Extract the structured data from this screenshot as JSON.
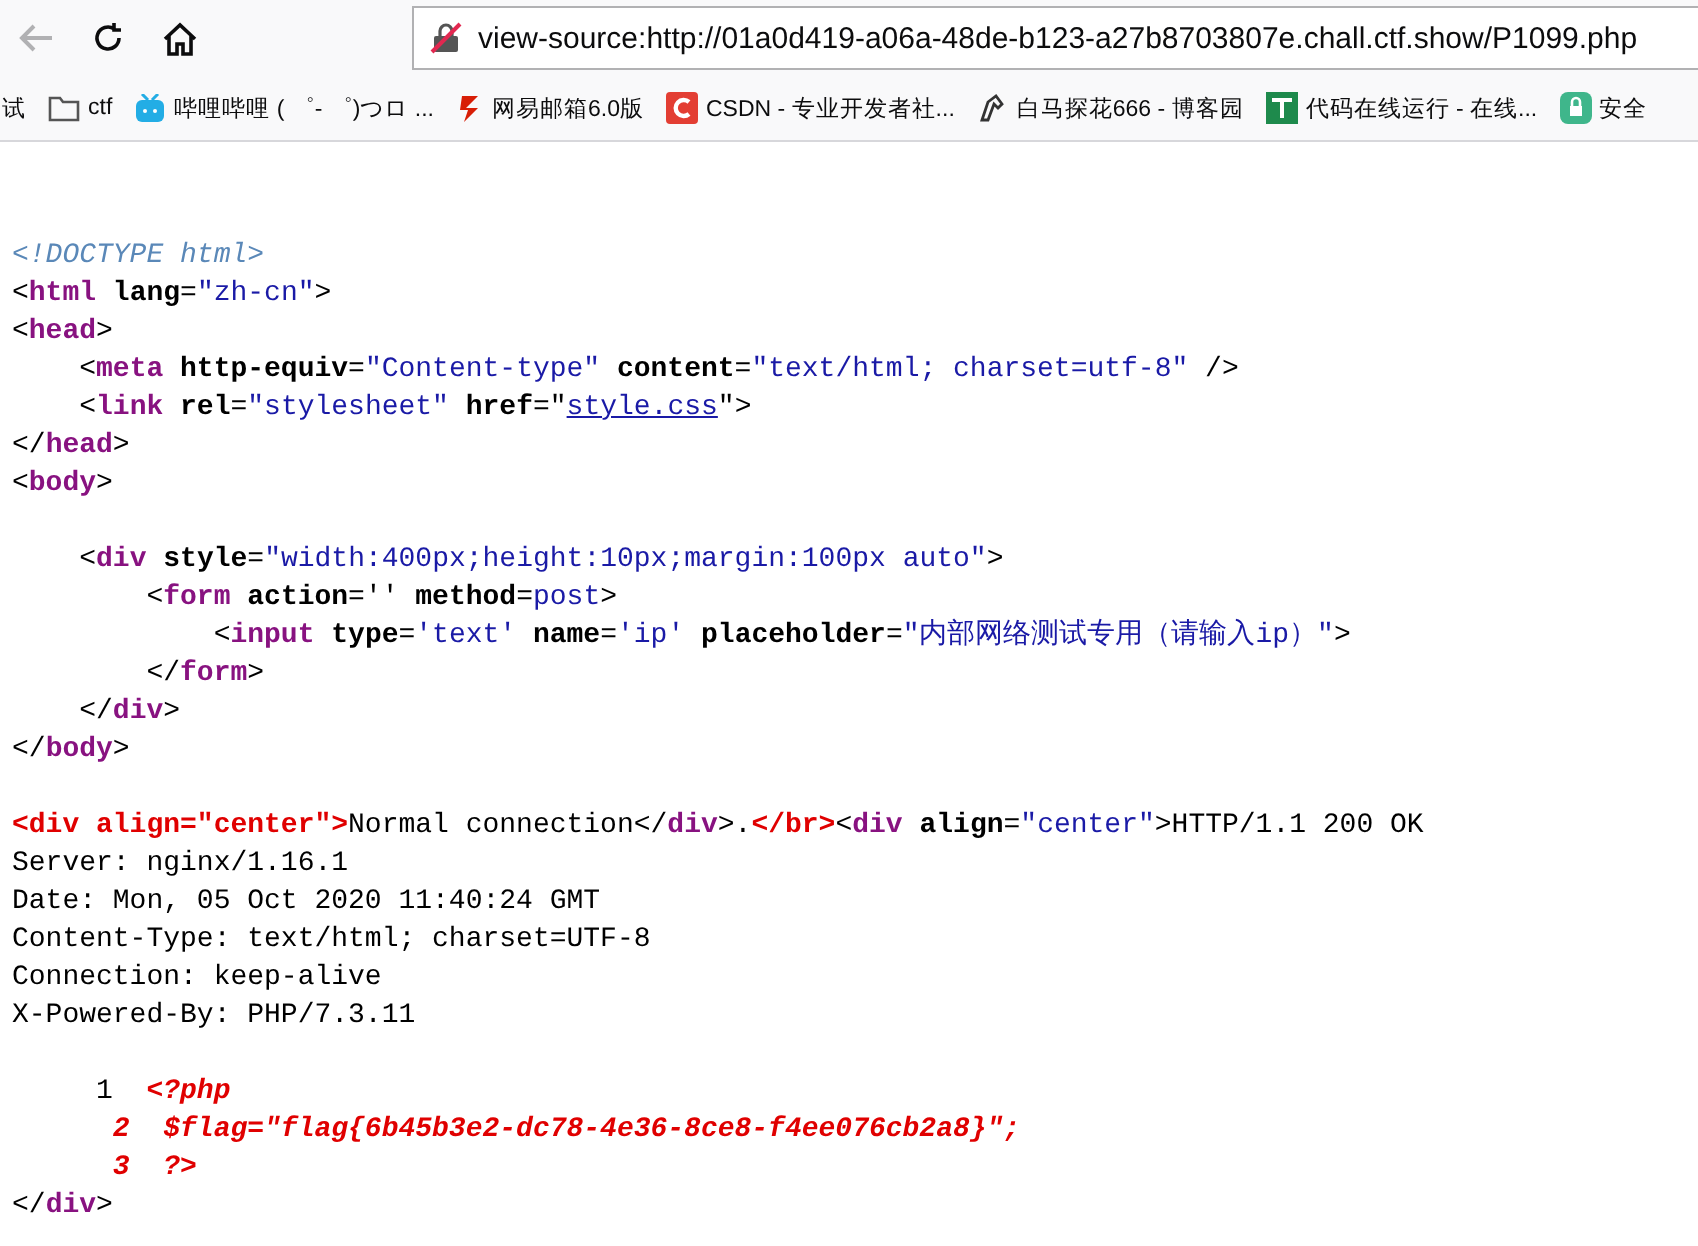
{
  "toolbar": {
    "back_disabled": true,
    "url": "view-source:http://01a0d419-a06a-48de-b123-a27b8703807e.chall.ctf.show/P1099.php"
  },
  "bookmarks": [
    {
      "kind": "plain",
      "label": "试"
    },
    {
      "kind": "folder",
      "label": "ctf"
    },
    {
      "kind": "tv",
      "label": "哔哩哔哩 ( ゜- ゜)つロ ..."
    },
    {
      "kind": "mail",
      "label": "网易邮箱6.0版"
    },
    {
      "kind": "c",
      "label": "CSDN - 专业开发者社..."
    },
    {
      "kind": "horse",
      "label": "白马探花666 - 博客园"
    },
    {
      "kind": "t",
      "label": "代码在线运行 - 在线..."
    },
    {
      "kind": "shield",
      "label": "安全"
    }
  ],
  "source_lines": [
    {
      "kind": "code",
      "tokens": [
        {
          "kind": "comment",
          "text": "<!DOCTYPE html>"
        }
      ]
    },
    {
      "kind": "code",
      "tokens": [
        {
          "kind": "punct",
          "text": "<"
        },
        {
          "kind": "tag",
          "text": "html"
        },
        {
          "kind": "attr",
          "text": " lang"
        },
        {
          "kind": "punct",
          "text": "="
        },
        {
          "kind": "value",
          "text": "\"zh-cn\""
        },
        {
          "kind": "punct",
          "text": ">"
        }
      ]
    },
    {
      "kind": "code",
      "tokens": [
        {
          "kind": "punct",
          "text": "<"
        },
        {
          "kind": "tag",
          "text": "head"
        },
        {
          "kind": "punct",
          "text": ">"
        }
      ]
    },
    {
      "kind": "code",
      "tokens": [
        {
          "kind": "punct",
          "text": "    <"
        },
        {
          "kind": "tag",
          "text": "meta"
        },
        {
          "kind": "attr",
          "text": " http-equiv"
        },
        {
          "kind": "punct",
          "text": "="
        },
        {
          "kind": "value",
          "text": "\"Content-type\""
        },
        {
          "kind": "attr",
          "text": " content"
        },
        {
          "kind": "punct",
          "text": "="
        },
        {
          "kind": "value",
          "text": "\"text/html; charset=utf-8\""
        },
        {
          "kind": "punct",
          "text": " />"
        }
      ]
    },
    {
      "kind": "code",
      "tokens": [
        {
          "kind": "punct",
          "text": "    <"
        },
        {
          "kind": "tag",
          "text": "link"
        },
        {
          "kind": "attr",
          "text": " rel"
        },
        {
          "kind": "punct",
          "text": "="
        },
        {
          "kind": "value",
          "text": "\"stylesheet\""
        },
        {
          "kind": "attr",
          "text": " href"
        },
        {
          "kind": "punct",
          "text": "=\""
        },
        {
          "kind": "link",
          "text": "style.css"
        },
        {
          "kind": "punct",
          "text": "\">"
        }
      ]
    },
    {
      "kind": "code",
      "tokens": [
        {
          "kind": "punct",
          "text": "</"
        },
        {
          "kind": "tag",
          "text": "head"
        },
        {
          "kind": "punct",
          "text": ">"
        }
      ]
    },
    {
      "kind": "code",
      "tokens": [
        {
          "kind": "punct",
          "text": "<"
        },
        {
          "kind": "tag",
          "text": "body"
        },
        {
          "kind": "punct",
          "text": ">"
        }
      ]
    },
    {
      "kind": "blank"
    },
    {
      "kind": "code",
      "tokens": [
        {
          "kind": "punct",
          "text": "    <"
        },
        {
          "kind": "tag",
          "text": "div"
        },
        {
          "kind": "attr",
          "text": " style"
        },
        {
          "kind": "punct",
          "text": "="
        },
        {
          "kind": "value",
          "text": "\"width:400px;height:10px;margin:100px auto\""
        },
        {
          "kind": "punct",
          "text": ">"
        }
      ]
    },
    {
      "kind": "code",
      "tokens": [
        {
          "kind": "punct",
          "text": "        <"
        },
        {
          "kind": "tag",
          "text": "form"
        },
        {
          "kind": "attr",
          "text": " action"
        },
        {
          "kind": "punct",
          "text": "='' "
        },
        {
          "kind": "attr",
          "text": "method"
        },
        {
          "kind": "punct",
          "text": "="
        },
        {
          "kind": "value",
          "text": "post"
        },
        {
          "kind": "punct",
          "text": ">"
        }
      ]
    },
    {
      "kind": "code",
      "tokens": [
        {
          "kind": "punct",
          "text": "            <"
        },
        {
          "kind": "tag",
          "text": "input"
        },
        {
          "kind": "attr",
          "text": " type"
        },
        {
          "kind": "punct",
          "text": "="
        },
        {
          "kind": "value",
          "text": "'text'"
        },
        {
          "kind": "attr",
          "text": " name"
        },
        {
          "kind": "punct",
          "text": "="
        },
        {
          "kind": "value",
          "text": "'ip'"
        },
        {
          "kind": "attr",
          "text": " placeholder"
        },
        {
          "kind": "punct",
          "text": "="
        },
        {
          "kind": "value",
          "text": "\"内部网络测试专用（请输入ip）\""
        },
        {
          "kind": "punct",
          "text": ">"
        }
      ]
    },
    {
      "kind": "code",
      "tokens": [
        {
          "kind": "punct",
          "text": "        </"
        },
        {
          "kind": "tag",
          "text": "form"
        },
        {
          "kind": "punct",
          "text": ">"
        }
      ]
    },
    {
      "kind": "code",
      "tokens": [
        {
          "kind": "punct",
          "text": "    </"
        },
        {
          "kind": "tag",
          "text": "div"
        },
        {
          "kind": "punct",
          "text": ">"
        }
      ]
    },
    {
      "kind": "code",
      "tokens": [
        {
          "kind": "punct",
          "text": "</"
        },
        {
          "kind": "tag",
          "text": "body"
        },
        {
          "kind": "punct",
          "text": ">"
        }
      ]
    },
    {
      "kind": "blank"
    },
    {
      "kind": "code",
      "tokens": [
        {
          "kind": "error",
          "text": "<div align=\"center\">"
        },
        {
          "kind": "text",
          "text": "Normal connection</"
        },
        {
          "kind": "tag",
          "text": "div"
        },
        {
          "kind": "text",
          "text": ">."
        },
        {
          "kind": "error",
          "text": "</br>"
        },
        {
          "kind": "punct",
          "text": "<"
        },
        {
          "kind": "tag",
          "text": "div"
        },
        {
          "kind": "attr",
          "text": " align"
        },
        {
          "kind": "punct",
          "text": "="
        },
        {
          "kind": "value",
          "text": "\"center\""
        },
        {
          "kind": "text",
          "text": ">HTTP/1.1 200 OK"
        }
      ]
    },
    {
      "kind": "code",
      "tokens": [
        {
          "kind": "text",
          "text": "Server: nginx/1.16.1"
        }
      ]
    },
    {
      "kind": "code",
      "tokens": [
        {
          "kind": "text",
          "text": "Date: Mon, 05 Oct 2020 11:40:24 GMT"
        }
      ]
    },
    {
      "kind": "code",
      "tokens": [
        {
          "kind": "text",
          "text": "Content-Type: text/html; charset=UTF-8"
        }
      ]
    },
    {
      "kind": "code",
      "tokens": [
        {
          "kind": "text",
          "text": "Connection: keep-alive"
        }
      ]
    },
    {
      "kind": "code",
      "tokens": [
        {
          "kind": "text",
          "text": "X-Powered-By: PHP/7.3.11"
        }
      ]
    },
    {
      "kind": "blank"
    },
    {
      "kind": "code",
      "tokens": [
        {
          "kind": "text",
          "text": "     1  "
        },
        {
          "kind": "php",
          "text": "<?php"
        }
      ]
    },
    {
      "kind": "code",
      "tokens": [
        {
          "kind": "php",
          "text": "      2  $flag=\"flag{6b45b3e2-dc78-4e36-8ce8-f4ee076cb2a8}\";"
        }
      ]
    },
    {
      "kind": "code",
      "tokens": [
        {
          "kind": "php",
          "text": "      3  ?>"
        }
      ]
    },
    {
      "kind": "code",
      "tokens": [
        {
          "kind": "punct",
          "text": "</"
        },
        {
          "kind": "tag",
          "text": "div"
        },
        {
          "kind": "punct",
          "text": ">"
        }
      ]
    }
  ]
}
